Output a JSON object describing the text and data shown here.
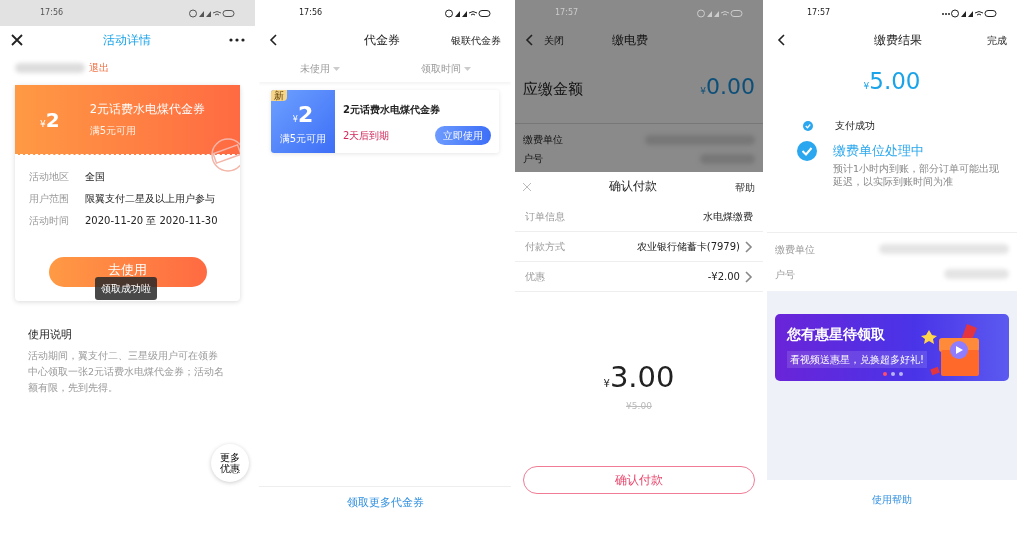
{
  "activity_detail": {
    "status_time": "17:56",
    "title": "活动详情",
    "logout": "退出",
    "coupon": {
      "currency": "¥",
      "amount": "2",
      "name": "2元话费水电煤代金券",
      "condition": "满5元可用"
    },
    "info_rows": [
      {
        "label": "活动地区",
        "value": "全国"
      },
      {
        "label": "用户范围",
        "value": "限翼支付二星及以上用户参与"
      },
      {
        "label": "活动时间",
        "value": "2020-11-20 至 2020-11-30"
      }
    ],
    "use_button": "去使用",
    "toast": "领取成功啦",
    "notes_title": "使用说明",
    "notes_text": "活动期间，翼支付二、三星级用户可在领券中心领取一张2元话费水电煤代金券；活动名额有限，先到先得。",
    "float_button": "更多优惠"
  },
  "vouchers": {
    "status_time": "17:56",
    "title": "代金券",
    "action": "银联代金券",
    "filters": [
      {
        "label": "未使用"
      },
      {
        "label": "领取时间"
      }
    ],
    "coupons": [
      {
        "badge": "新",
        "currency": "¥",
        "amount": "2",
        "condition": "满5元可用",
        "name": "2元话费水电煤代金券",
        "expiry": "2天后到期",
        "button": "立即使用"
      }
    ],
    "footer_link": "领取更多代金券"
  },
  "payment": {
    "status_time": "17:57",
    "back_label": "关闭",
    "title": "缴电费",
    "due_label": "应缴金额",
    "currency": "¥",
    "due_amount": "0.00",
    "background_rows": [
      {
        "label": "缴费单位"
      },
      {
        "label": "户号"
      }
    ],
    "sheet": {
      "title": "确认付款",
      "help": "帮助",
      "rows": [
        {
          "label": "订单信息",
          "value": "水电煤缴费",
          "arrow": false
        },
        {
          "label": "付款方式",
          "value": "农业银行储蓄卡(7979)",
          "arrow": true
        },
        {
          "label": "优惠",
          "value": "-¥2.00",
          "arrow": true
        }
      ],
      "currency": "¥",
      "amount": "3.00",
      "original_price": "¥5.00",
      "confirm_button": "确认付款"
    }
  },
  "result": {
    "status_time": "17:57",
    "title": "缴费结果",
    "done": "完成",
    "currency": "¥",
    "amount": "5.00",
    "steps": [
      {
        "title": "支付成功",
        "active": false
      },
      {
        "title": "缴费单位处理中",
        "note": "预计1小时内到账，部分订单可能出现延迟，以实际到账时间为准",
        "active": true
      }
    ],
    "info_rows": [
      {
        "label": "缴费单位"
      },
      {
        "label": "户号"
      }
    ],
    "banner": {
      "title": "您有惠星待领取",
      "subtitle": "看视频送惠星，兑换超多好礼!",
      "dots": [
        {
          "selected": true
        },
        {
          "selected": false
        },
        {
          "selected": false
        }
      ]
    },
    "help_link": "使用帮助"
  }
}
